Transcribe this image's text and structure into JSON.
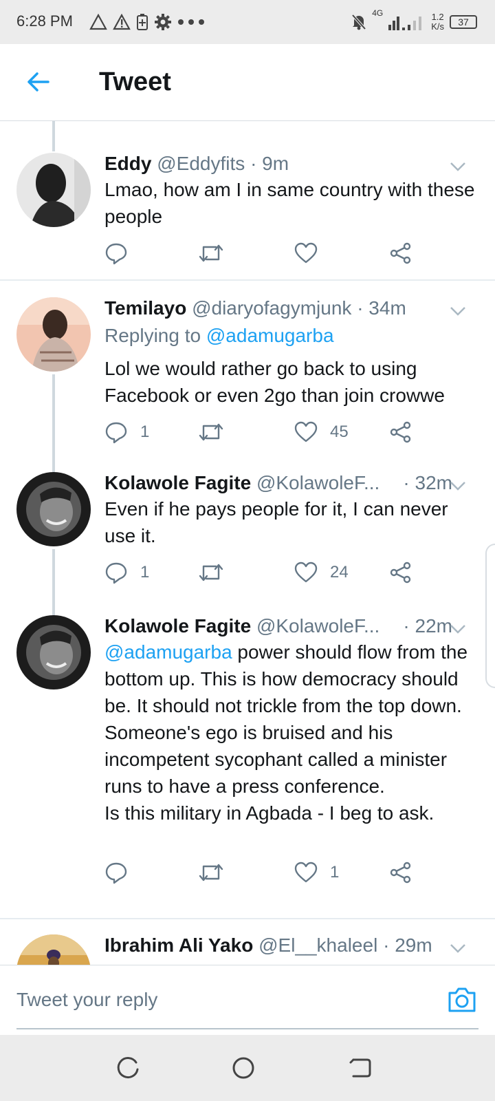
{
  "status_bar": {
    "time": "6:28 PM",
    "network": "4G",
    "speed_value": "1.2",
    "speed_unit": "K/s",
    "battery": "37"
  },
  "header": {
    "title": "Tweet"
  },
  "tweets": [
    {
      "name": "Eddy",
      "handle": "@Eddyfits",
      "time": "9m",
      "body": "Lmao, how am I in same country with these people",
      "reply_count": "",
      "like_count": ""
    },
    {
      "name": "Temilayo",
      "handle": "@diaryofagymjunk",
      "time": "34m",
      "replying_label": "Replying to",
      "replying_to": "@adamugarba",
      "body": "Lol we would rather go back to using Facebook or even 2go than join crowwe",
      "reply_count": "1",
      "like_count": "45"
    },
    {
      "name": "Kolawole Fagite",
      "handle": "@KolawoleF...",
      "time": "32m",
      "body": "Even if he pays people for it, I can never use it.",
      "reply_count": "1",
      "like_count": "24"
    },
    {
      "name": "Kolawole Fagite",
      "handle": "@KolawoleF...",
      "time": "22m",
      "mention": "@adamugarba",
      "body_line1": " power should flow from the bottom up. This is how democracy should be. It should not trickle from the top down.",
      "body_line2": "Someone's ego is bruised and his incompetent sycophant called a minister runs to have a press conference.",
      "body_line3": "Is this military in Agbada - I beg to ask.",
      "reply_count": "",
      "like_count": "1"
    },
    {
      "name": "Ibrahim Ali Yako",
      "handle": "@El__khaleel",
      "time": "29m"
    }
  ],
  "composer": {
    "placeholder": "Tweet your reply"
  },
  "colors": {
    "accent": "#1da1f2",
    "muted": "#657786",
    "text": "#14171a"
  },
  "icons": [
    "back-arrow-icon",
    "chevron-down-icon",
    "reply-icon",
    "retweet-icon",
    "like-icon",
    "share-icon",
    "camera-icon",
    "recents-icon",
    "home-icon",
    "back-nav-icon"
  ]
}
